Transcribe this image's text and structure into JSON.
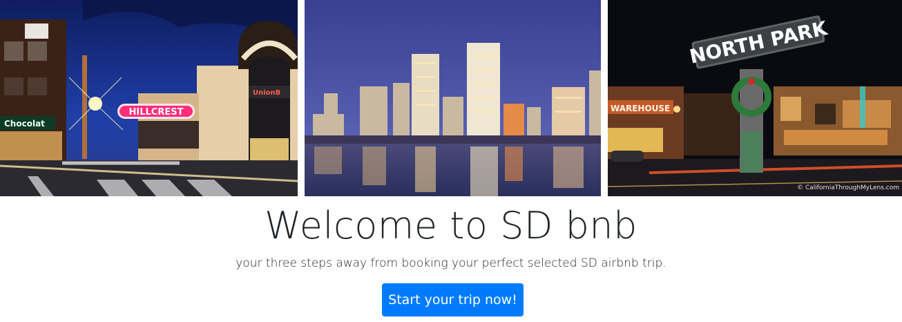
{
  "photos": [
    {
      "name": "Hillcrest sign at night",
      "sign_text": "HILLCREST",
      "storefront_text": "Chocolat",
      "bank_text": "UnionB"
    },
    {
      "name": "San Diego skyline across the bay at dusk"
    },
    {
      "name": "North Park sign at night",
      "sign_text": "NORTH PARK",
      "storefront_text": "WAREHOUSE",
      "credit": "© CaliforniaThroughMyLens.com"
    }
  ],
  "hero": {
    "title": "Welcome to SD bnb",
    "lead": "your three steps away from booking your perfect selected SD airbnb trip.",
    "cta_label": "Start your trip now!"
  },
  "colors": {
    "primary": "#007bff",
    "text": "#212529"
  }
}
